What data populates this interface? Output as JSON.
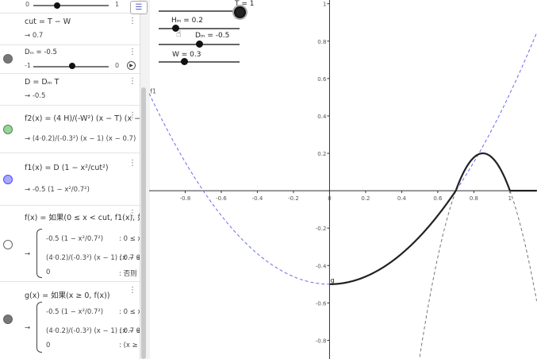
{
  "algebra": {
    "top_slider": {
      "min": "0",
      "max": "1",
      "value_fraction": 0.38
    },
    "cut": {
      "def": "cut = T − W",
      "val": "→ 0.7"
    },
    "dm": {
      "def": "Dₘ = -0.5",
      "min": "-1",
      "max": "0",
      "value_fraction": 0.5
    },
    "d": {
      "def": "D = Dₘ T",
      "val": "→ -0.5"
    },
    "f2": {
      "def": "f2(x) = (4 H)/(-W²) (x − T) (x − cut)",
      "val": "→ (4·0.2)/(-0.3²) (x − 1) (x − 0.7)",
      "color": "#2f9e44"
    },
    "f1": {
      "def": "f1(x) = D (1 − x²/cut²)",
      "val": "→ -0.5 (1 − x²/0.7²)",
      "color": "#4c4cff"
    },
    "f": {
      "def": "f(x) = 如果(0 ≤ x < cut, f1(x), 如果(cut",
      "cases": [
        {
          "expr": "-0.5 (1 − x²/0.7²)",
          "cond": ": 0 ≤ x"
        },
        {
          "expr": "(4·0.2)/(-0.3²) (x − 1) (x − 0.7)",
          "cond": ": 0.7 ≤"
        },
        {
          "expr": "0",
          "cond": ": 否则"
        }
      ]
    },
    "g": {
      "def": "g(x) = 如果(x ≥ 0, f(x))",
      "cases": [
        {
          "expr": "-0.5 (1 − x²/0.7²)",
          "cond": ": 0 ≤ x"
        },
        {
          "expr": "(4·0.2)/(-0.3²) (x − 1) (x − 0.7)",
          "cond": ": 0.7 ≤"
        },
        {
          "expr": "0",
          "cond": ": (x ≥ 0"
        }
      ]
    },
    "menu_glyph": "⋮"
  },
  "graphics": {
    "sliders": [
      {
        "label": "T = 1",
        "value_fraction": 1.0
      },
      {
        "label": "Hₘ = 0.2",
        "value_fraction": 0.2
      },
      {
        "label": "Dₘ = -0.5",
        "value_fraction": 0.5
      },
      {
        "label": "W = 0.3",
        "value_fraction": 0.3
      }
    ],
    "curve_labels": {
      "f1": "f1",
      "g": "g"
    }
  },
  "chart_data": {
    "type": "line",
    "xlim": [
      -1.0,
      1.15
    ],
    "ylim": [
      -0.9,
      1.02
    ],
    "x_ticks": [
      -0.8,
      -0.6,
      -0.4,
      -0.2,
      0,
      0.2,
      0.4,
      0.6,
      0.8,
      1
    ],
    "y_ticks": [
      -0.8,
      -0.6,
      -0.4,
      -0.2,
      0.2,
      0.4,
      0.6,
      0.8,
      1
    ],
    "series": [
      {
        "name": "f1",
        "style": "dashed",
        "color": "#6a6af0",
        "fn": "-0.5*(1-x^2/0.49)",
        "domain": [
          -1.0,
          1.15
        ]
      },
      {
        "name": "f2",
        "style": "dashed",
        "color": "#777777",
        "fn": "(0.8/-0.09)*(x-1)*(x-0.7)",
        "domain": [
          0.5,
          1.15
        ]
      },
      {
        "name": "g",
        "style": "solid",
        "color": "#222222",
        "fn": "piecewise",
        "domain": [
          0,
          1.15
        ]
      }
    ]
  }
}
